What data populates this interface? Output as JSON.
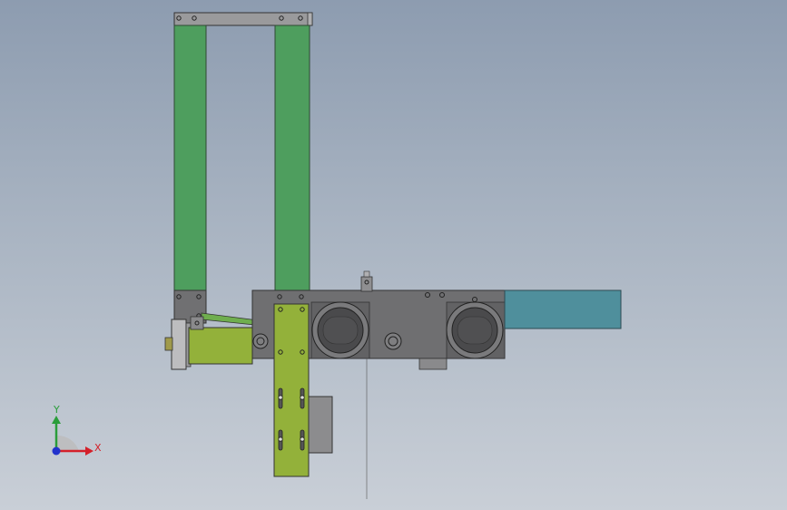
{
  "viewport": {
    "background_top": "#8d9cb0",
    "background_bottom": "#c9cfd7"
  },
  "model": {
    "colors": {
      "frame_green": "#4e9e5e",
      "plate_olive": "#93b13a",
      "housing_gray": "#6f6f71",
      "housing_dark": "#58585a",
      "wheel_dark": "#4a4a4c",
      "teal_block": "#4f8f9c",
      "top_bar": "#9a9a9c"
    }
  },
  "triad": {
    "x_label": "X",
    "y_label": "Y",
    "x_color": "#d4202a",
    "y_color": "#2a9d3a",
    "z_color": "#2233cc"
  }
}
